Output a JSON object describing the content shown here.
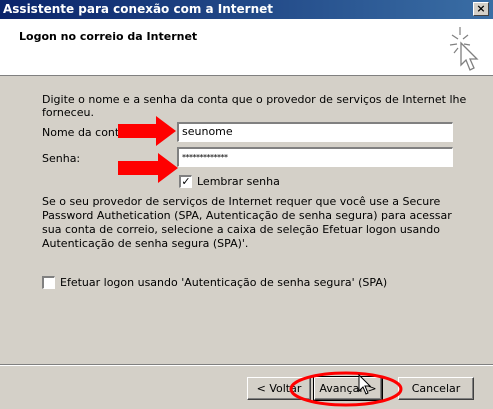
{
  "window": {
    "title": "Assistente para conexão com a Internet",
    "close_glyph": "×"
  },
  "header": {
    "title": "Logon no correio da Internet"
  },
  "intro": "Digite o nome e a senha da conta que o provedor de serviços de Internet lhe forneceu.",
  "form": {
    "account_label": "Nome da conta:",
    "account_value": "seunome",
    "password_label": "Senha:",
    "password_value": "*************",
    "remember_label": "Lembrar senha",
    "remember_checked": true,
    "check_glyph": "✓"
  },
  "spa_paragraph": "Se o seu provedor de serviços de Internet requer que você use a Secure Password Authetication (SPA, Autenticação de senha segura) para acessar sua conta de correio, selecione a caixa de seleção Efetuar logon usando Autenticação de senha segura (SPA)'.",
  "spa_checkbox": {
    "label": "Efetuar logon usando 'Autenticação de senha segura' (SPA)",
    "checked": false
  },
  "buttons": {
    "back": "< Voltar",
    "next": "Avançar >",
    "cancel": "Cancelar"
  },
  "colors": {
    "arrow": "#ff0000",
    "highlight_ellipse": "#ff0000",
    "title_bar": "#0a246a"
  }
}
